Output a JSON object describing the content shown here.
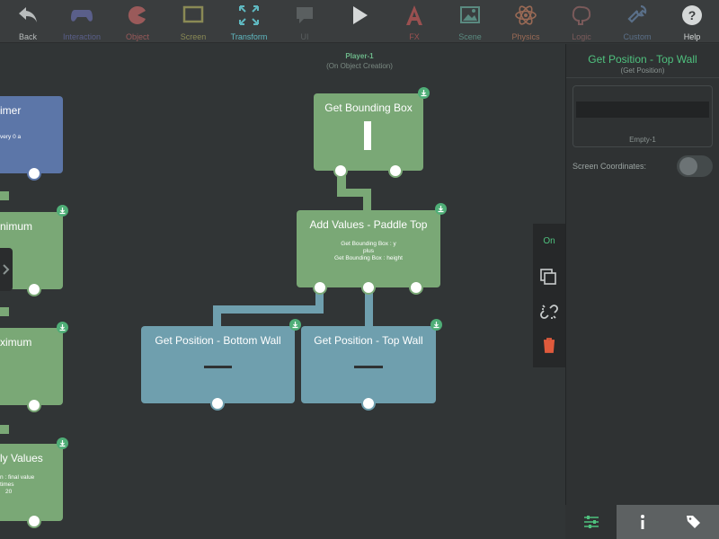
{
  "toolbar": {
    "items": [
      {
        "label": "Back",
        "icon": "back-arrow-icon",
        "color": "#b8bcbc"
      },
      {
        "label": "Interaction",
        "icon": "gamepad-icon",
        "color": "#5a5f8a"
      },
      {
        "label": "Object",
        "icon": "pacman-icon",
        "color": "#9a5a5a"
      },
      {
        "label": "Screen",
        "icon": "screen-icon",
        "color": "#8a8a55"
      },
      {
        "label": "Transform",
        "icon": "transform-icon",
        "color": "#5fb8c0"
      },
      {
        "label": "UI",
        "icon": "speech-bubble-icon",
        "color": "#5a5f60"
      },
      {
        "label": "",
        "icon": "play-icon",
        "color": "#d5d8d8"
      },
      {
        "label": "FX",
        "icon": "fx-icon",
        "color": "#9a5050"
      },
      {
        "label": "Scene",
        "icon": "image-icon",
        "color": "#5a8a80"
      },
      {
        "label": "Physics",
        "icon": "atom-icon",
        "color": "#9a6a55"
      },
      {
        "label": "Logic",
        "icon": "brain-icon",
        "color": "#7a5a5a"
      },
      {
        "label": "Custom",
        "icon": "wrench-icon",
        "color": "#5a6f88"
      },
      {
        "label": "Help",
        "icon": "help-icon",
        "color": "#d5d8d8"
      }
    ]
  },
  "canvas": {
    "player": "Player-1",
    "event": "(On Object Creation)",
    "blocks": {
      "timer": {
        "title": "imer",
        "line1": "very 0 a"
      },
      "minimum": {
        "title": "nimum"
      },
      "maximum": {
        "title": "ximum"
      },
      "multiply": {
        "title": "ly Values",
        "line1": "n : final value",
        "line2": "times",
        "line3": "20"
      },
      "bounding": {
        "title": "Get Bounding Box"
      },
      "add": {
        "title": "Add Values - Paddle Top",
        "line1": "Get Bounding Box : y",
        "line2": "plus",
        "line3": "Get Bounding Box : height"
      },
      "bottom": {
        "title": "Get Position - Bottom Wall"
      },
      "top": {
        "title": "Get Position - Top Wall"
      }
    }
  },
  "actions": {
    "on_label": "On"
  },
  "panel": {
    "title": "Get Position - Top Wall",
    "subtitle": "(Get Position)",
    "object_label": "Empty-1",
    "screen_coordinates_label": "Screen Coordinates:",
    "screen_coordinates_on": false
  },
  "tabs": [
    {
      "icon": "sliders-icon",
      "active": true
    },
    {
      "icon": "info-icon",
      "active": false
    },
    {
      "icon": "tags-icon",
      "active": false
    }
  ],
  "colors": {
    "accent": "#4fc17e",
    "green_block": "#7aa876",
    "blue_block": "#5c76a8",
    "teal_block": "#6f9fae"
  }
}
